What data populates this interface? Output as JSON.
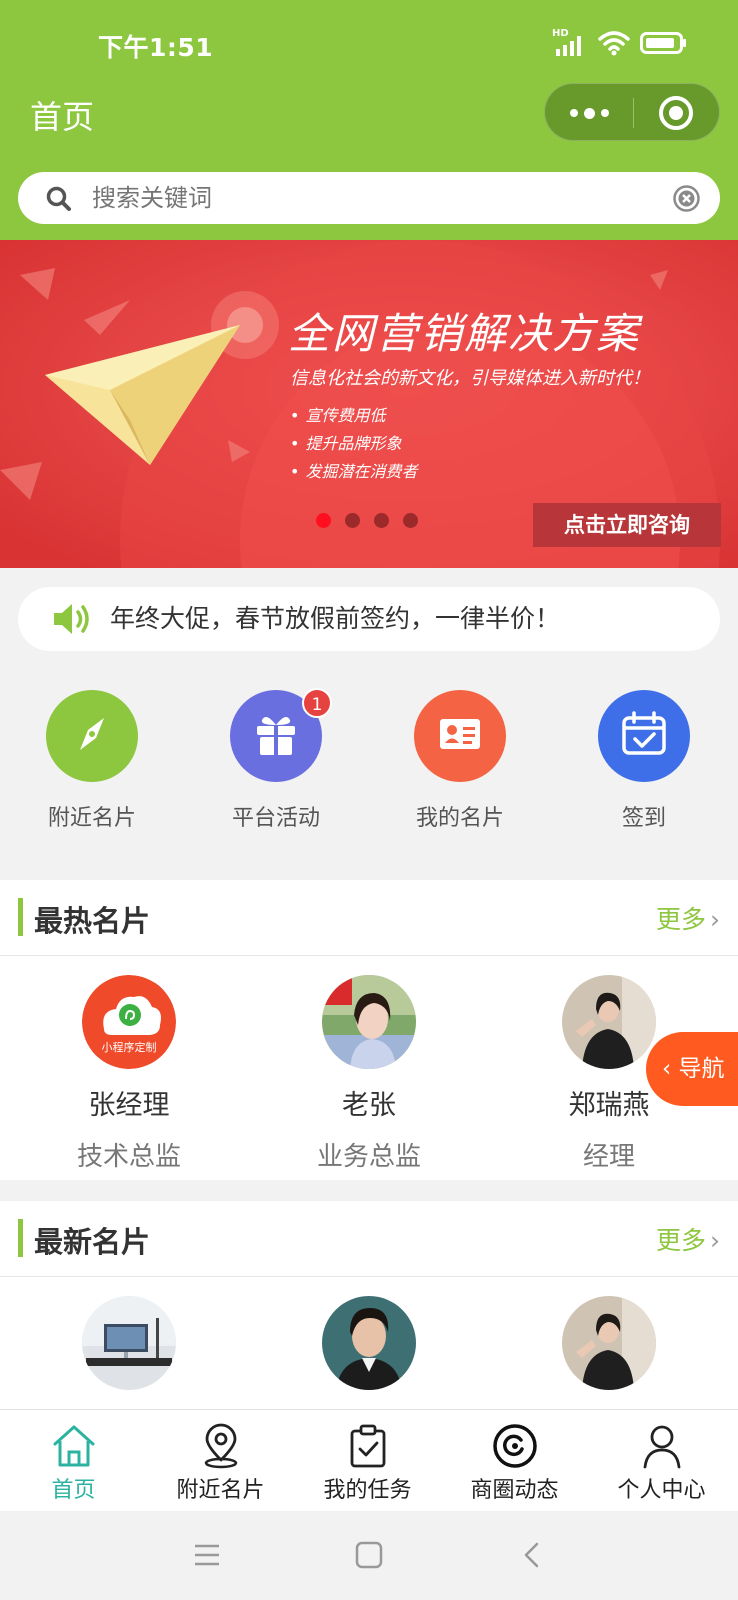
{
  "status": {
    "time": "下午1:51",
    "network": "HD"
  },
  "nav": {
    "title": "首页"
  },
  "search": {
    "placeholder": "搜索关键词"
  },
  "banner": {
    "title": "全网营销解决方案",
    "subtitle": "信息化社会的新文化，引导媒体进入新时代！",
    "points": [
      "宣传费用低",
      "提升品牌形象",
      "发掘潜在消费者"
    ],
    "cta": "点击立即咨询",
    "slide_count": 4,
    "active_slide": 1
  },
  "notice": {
    "text": "年终大促，春节放假前签约，一律半价！"
  },
  "menu": [
    {
      "label": "附近名片",
      "icon": "compass-icon",
      "color": "#8dc63f"
    },
    {
      "label": "平台活动",
      "icon": "gift-icon",
      "color": "#6a6fe0",
      "badge": "1"
    },
    {
      "label": "我的名片",
      "icon": "id-card-icon",
      "color": "#f46444"
    },
    {
      "label": "签到",
      "icon": "calendar-check-icon",
      "color": "#3f6fe8"
    }
  ],
  "hot": {
    "title": "最热名片",
    "more": "更多",
    "cards": [
      {
        "name": "张经理",
        "role": "技术总监",
        "logo_text": "小程序定制"
      },
      {
        "name": "老张",
        "role": "业务总监"
      },
      {
        "name": "郑瑞燕",
        "role": "经理"
      }
    ]
  },
  "newest": {
    "title": "最新名片",
    "more": "更多"
  },
  "float_nav": {
    "label": "‹ 导航"
  },
  "tabbar": [
    {
      "label": "首页",
      "icon": "home-icon",
      "active": true
    },
    {
      "label": "附近名片",
      "icon": "location-pin-icon"
    },
    {
      "label": "我的任务",
      "icon": "task-clipboard-icon"
    },
    {
      "label": "商圈动态",
      "icon": "moments-icon"
    },
    {
      "label": "个人中心",
      "icon": "user-icon"
    }
  ],
  "colors": {
    "brand": "#8dc63f",
    "active_tab": "#2bb3a0",
    "accent": "#ff5a1f"
  }
}
